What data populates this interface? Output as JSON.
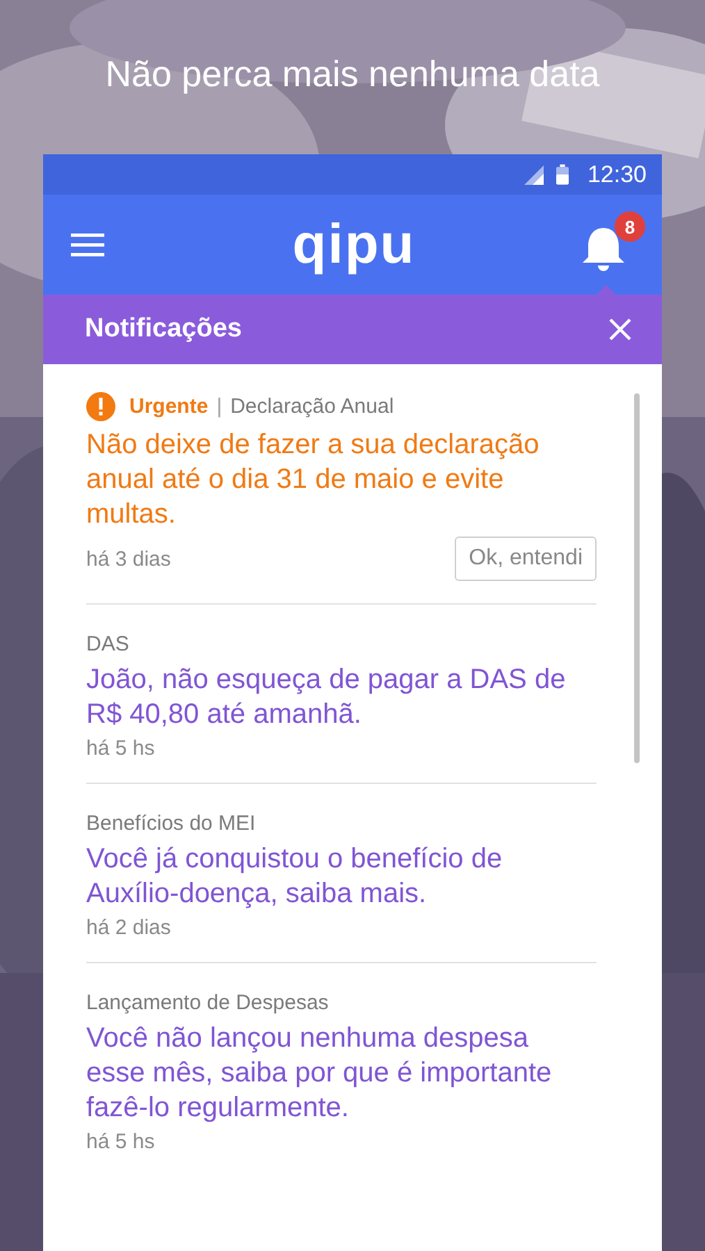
{
  "headline": "Não perca mais nenhuma data",
  "status_bar": {
    "time": "12:30"
  },
  "app_bar": {
    "logo": "qipu",
    "notification_count": "8"
  },
  "panel": {
    "title": "Notificações"
  },
  "notifications": [
    {
      "kind": "urgent",
      "tag": "Urgente",
      "separator": "|",
      "category": "Declaração Anual",
      "message": "Não deixe de fazer a sua declaração anual até o dia 31 de maio e evite multas.",
      "time": "há 3 dias",
      "action": "Ok, entendi"
    },
    {
      "kind": "normal",
      "category": "DAS",
      "message": "João, não esqueça de pagar a DAS de R$ 40,80 até amanhã.",
      "time": "há 5 hs"
    },
    {
      "kind": "normal",
      "category": "Benefícios do MEI",
      "message": "Você já conquistou o benefício de Auxílio-doença, saiba mais.",
      "time": "há 2 dias"
    },
    {
      "kind": "normal",
      "category": "Lançamento de Despesas",
      "message": "Você não lançou nenhuma despesa esse mês, saiba por que é importante fazê-lo regularmente.",
      "time": "há 5 hs"
    }
  ]
}
